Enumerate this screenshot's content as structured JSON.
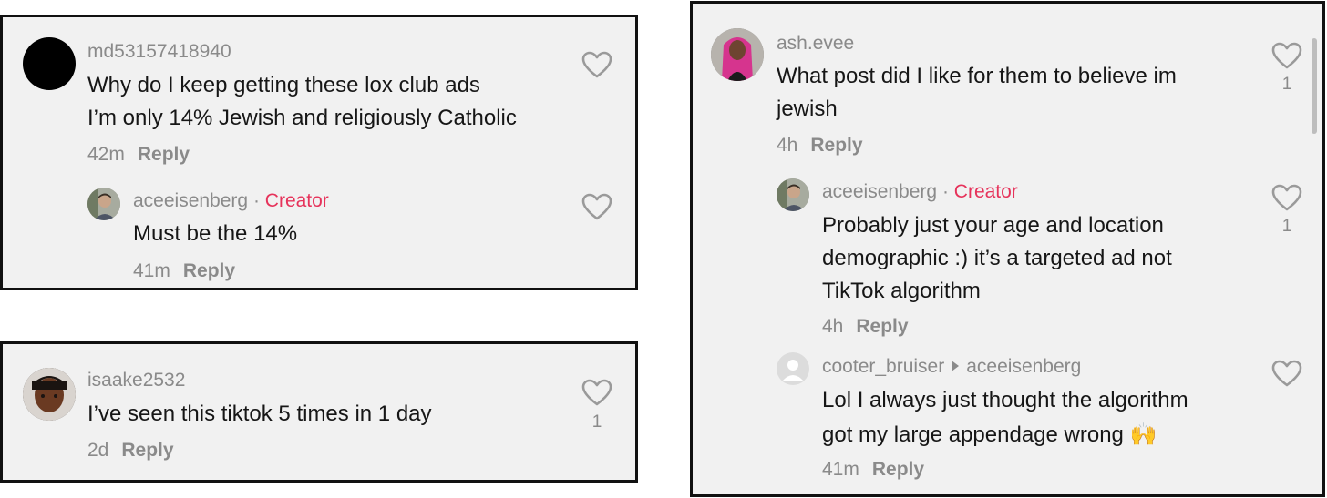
{
  "panel1": {
    "comment": {
      "username": "md53157418940",
      "lines": [
        "Why do I keep getting these lox club ads",
        "I’m only 14% Jewish and religiously Catholic"
      ],
      "time": "42m",
      "reply": "Reply"
    },
    "reply1": {
      "username": "aceeisenberg",
      "dot": "·",
      "creator": "Creator",
      "lines": [
        "Must be the 14%"
      ],
      "time": "41m",
      "reply": "Reply"
    }
  },
  "panel2": {
    "comment": {
      "username": "isaake2532",
      "lines": [
        "I’ve seen this tiktok 5 times in 1 day"
      ],
      "time": "2d",
      "reply": "Reply",
      "likes": "1"
    }
  },
  "panel3": {
    "comment": {
      "username": "ash.evee",
      "lines": [
        "What post did I like for them to believe im",
        "jewish"
      ],
      "time": "4h",
      "reply": "Reply",
      "likes": "1"
    },
    "reply1": {
      "username": "aceeisenberg",
      "dot": "·",
      "creator": "Creator",
      "lines": [
        "Probably just your age and location",
        "demographic :) it’s a targeted ad not",
        "TikTok algorithm"
      ],
      "time": "4h",
      "reply": "Reply",
      "likes": "1"
    },
    "reply2": {
      "username": "cooter_bruiser",
      "reply_to": "aceeisenberg",
      "lines": [
        "Lol I always just thought the algorithm",
        "got my large appendage wrong 🙌"
      ],
      "time": "41m",
      "reply": "Reply"
    }
  },
  "colors": {
    "panel_bg": "#f1f1f1",
    "creator": "#e6335b",
    "muted": "#8a8a8a",
    "text": "#161616"
  },
  "icons": [
    "heart-outline-icon",
    "default-avatar-icon",
    "reply-arrow-icon"
  ]
}
